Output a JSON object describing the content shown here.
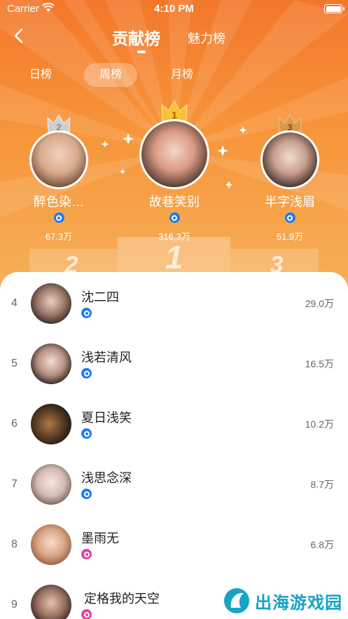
{
  "status": {
    "carrier": "Carrier",
    "time": "4:10 PM"
  },
  "nav": {
    "main_tab": "贡献榜",
    "secondary_tab": "魅力榜"
  },
  "periods": [
    "日榜",
    "周榜",
    "月榜"
  ],
  "podium_numbers": [
    "2",
    "1",
    "3"
  ],
  "top3": [
    {
      "rank": "2",
      "name": "醉色染…",
      "value": "67.3万",
      "badge": "blue",
      "crown_color": "#c9c9c9"
    },
    {
      "rank": "1",
      "name": "故巷笑别",
      "value": "316.3万",
      "badge": "blue",
      "crown_color": "#f6c431"
    },
    {
      "rank": "3",
      "name": "半字浅眉",
      "value": "51.9万",
      "badge": "blue",
      "crown_color": "#d9984f"
    }
  ],
  "list": [
    {
      "rank": "4",
      "name": "沈二四",
      "value": "29.0万",
      "badge": "blue"
    },
    {
      "rank": "5",
      "name": "浅若清风",
      "value": "16.5万",
      "badge": "blue"
    },
    {
      "rank": "6",
      "name": "夏日浅笑",
      "value": "10.2万",
      "badge": "blue"
    },
    {
      "rank": "7",
      "name": "浅思念深",
      "value": "8.7万",
      "badge": "blue"
    },
    {
      "rank": "8",
      "name": "墨雨无",
      "value": "6.8万",
      "badge": "pink"
    },
    {
      "rank": "9",
      "name": "定格我的天空",
      "value": "",
      "badge": "pink"
    }
  ],
  "watermark": "出海游戏园",
  "colors": {
    "accent": "#f3772a",
    "badge_blue": "#1e7cf2",
    "badge_pink": "#e83e9a"
  }
}
